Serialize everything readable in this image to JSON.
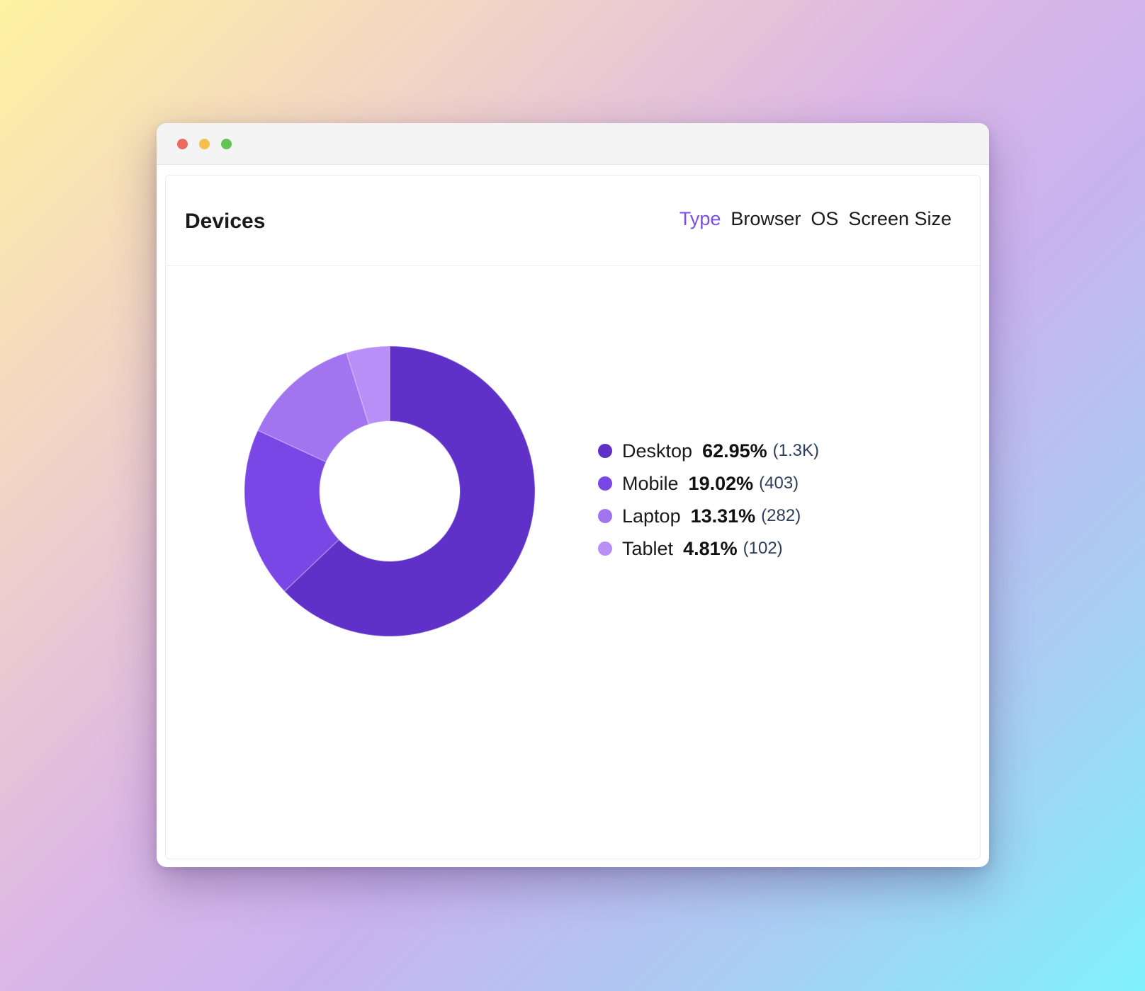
{
  "panel": {
    "title": "Devices",
    "tabs": [
      {
        "label": "Type",
        "active": true
      },
      {
        "label": "Browser",
        "active": false
      },
      {
        "label": "OS",
        "active": false
      },
      {
        "label": "Screen Size",
        "active": false
      }
    ]
  },
  "colors": {
    "accent": "#7c4ee4",
    "window_close": "#ed6a5e",
    "window_minimize": "#f5bf4f",
    "window_maximize": "#61c554"
  },
  "chart_data": {
    "type": "pie",
    "donut": true,
    "legend_position": "right",
    "slices": [
      {
        "label": "Desktop",
        "percent": 62.95,
        "percent_text": "62.95%",
        "count_text": "(1.3K)",
        "color": "#5f31c9"
      },
      {
        "label": "Mobile",
        "percent": 19.02,
        "percent_text": "19.02%",
        "count_text": "(403)",
        "color": "#7a46e6"
      },
      {
        "label": "Laptop",
        "percent": 13.31,
        "percent_text": "13.31%",
        "count_text": "(282)",
        "color": "#a274ef"
      },
      {
        "label": "Tablet",
        "percent": 4.81,
        "percent_text": "4.81%",
        "count_text": "(102)",
        "color": "#b98ef6"
      }
    ]
  }
}
